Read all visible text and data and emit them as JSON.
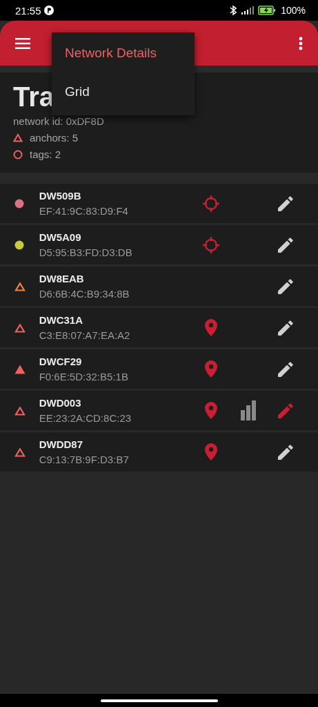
{
  "status_bar": {
    "time": "21:55",
    "battery": "100%"
  },
  "menu": {
    "items": [
      {
        "label": "Network Details",
        "selected": true
      },
      {
        "label": "Grid",
        "selected": false
      }
    ]
  },
  "header": {
    "title": "Tra",
    "network_id": "network id: 0xDF8D",
    "anchors": "anchors: 5",
    "tags": "tags: 2"
  },
  "devices": [
    {
      "kind": "tag",
      "name": "DW509B",
      "address": "EF:41:9C:83:D9:F4",
      "color": "#d9737f",
      "filled": true,
      "tracking": true,
      "positioned": false,
      "signal": false,
      "edit_active": false
    },
    {
      "kind": "tag",
      "name": "DW5A09",
      "address": "D5:95:B3:FD:D3:DB",
      "color": "#c8cc36",
      "filled": true,
      "tracking": true,
      "positioned": false,
      "signal": false,
      "edit_active": false
    },
    {
      "kind": "anchor",
      "name": "DW8EAB",
      "address": "D6:6B:4C:B9:34:8B",
      "color": "#f0823c",
      "filled": false,
      "tracking": false,
      "positioned": false,
      "signal": false,
      "edit_active": false
    },
    {
      "kind": "anchor",
      "name": "DWC31A",
      "address": "C3:E8:07:A7:EA:A2",
      "color": "#ef6060",
      "filled": false,
      "tracking": false,
      "positioned": true,
      "signal": false,
      "edit_active": false
    },
    {
      "kind": "anchor",
      "name": "DWCF29",
      "address": "F0:6E:5D:32:B5:1B",
      "color": "#ef6060",
      "filled": true,
      "tracking": false,
      "positioned": true,
      "signal": false,
      "edit_active": false
    },
    {
      "kind": "anchor",
      "name": "DWD003",
      "address": "EE:23:2A:CD:8C:23",
      "color": "#ef6060",
      "filled": false,
      "tracking": false,
      "positioned": true,
      "signal": true,
      "edit_active": true
    },
    {
      "kind": "anchor",
      "name": "DWDD87",
      "address": "C9:13:7B:9F:D3:B7",
      "color": "#ef6060",
      "filled": false,
      "tracking": false,
      "positioned": true,
      "signal": false,
      "edit_active": false
    }
  ]
}
